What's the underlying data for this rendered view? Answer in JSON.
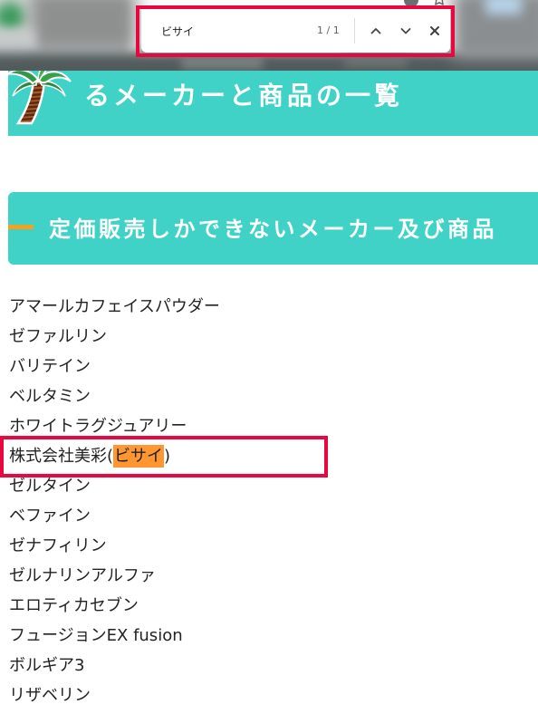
{
  "toolbar": {
    "icons": [
      "toolbar-icon",
      "bookmark-star-icon"
    ]
  },
  "find_bar": {
    "query": "ビサイ",
    "match_count": "1 / 1",
    "icons": {
      "previous": "chevron-up-icon",
      "next": "chevron-down-icon",
      "close": "close-icon"
    }
  },
  "page": {
    "banner": {
      "icon": "palm-tree-icon",
      "title": "るメーカーと商品の一覧"
    },
    "section": {
      "heading": "定価販売しかできないメーカー及び商品"
    },
    "products": [
      {
        "text": "アマールカフェイスパウダー"
      },
      {
        "text": "ゼファルリン"
      },
      {
        "text": "バリテイン"
      },
      {
        "text": "ベルタミン"
      },
      {
        "text": "ホワイトラグジュアリー"
      },
      {
        "before": "株式会社美彩(",
        "match": "ビサイ",
        "after": ")"
      },
      {
        "text": "ゼルタイン"
      },
      {
        "text": "ベファイン"
      },
      {
        "text": "ゼナフィリン"
      },
      {
        "text": "ゼルナリンアルファ"
      },
      {
        "text": "エロティカセブン"
      },
      {
        "text": "フュージョンEX fusion"
      },
      {
        "text": "ボルギア3"
      },
      {
        "text": "リザベリン"
      }
    ]
  },
  "colors": {
    "banner_teal": "#40d2c6",
    "heading_accent": "#f5a01e",
    "find_highlight": "#ff9632",
    "annotation_red": "#e8073f",
    "text_color": "#222222"
  }
}
